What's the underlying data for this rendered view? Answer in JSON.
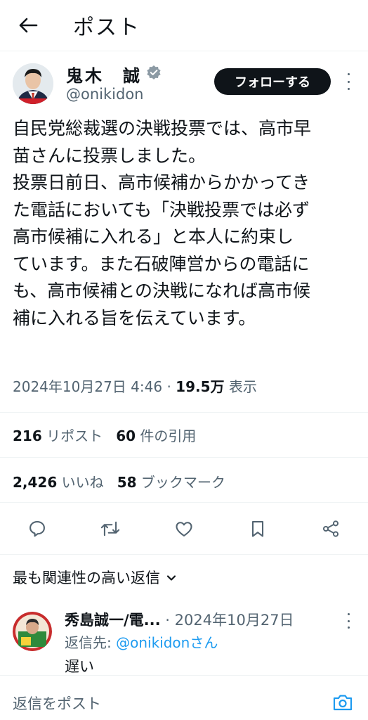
{
  "header": {
    "title": "ポスト"
  },
  "author": {
    "name": "鬼木　誠",
    "handle": "@onikidon",
    "follow_label": "フォローする"
  },
  "tweet": {
    "lines": [
      "自民党総裁選の決戦投票では、高市早",
      "苗さんに投票しました。",
      "投票日前日、高市候補からかかってき",
      "た電話においても「決戦投票では必ず",
      "高市候補に入れる」と本人に約束し",
      "ています。また石破陣営からの電話に",
      "も、高市候補との決戦になれば高市候",
      "補に入れる旨を伝えています。"
    ],
    "timestamp": "2024年10月27日 4:46",
    "separator": "·",
    "views": "19.5万",
    "views_label": "表示"
  },
  "stats": {
    "reposts": "216",
    "reposts_label": "リポスト",
    "quotes": "60",
    "quotes_label": "件の引用",
    "likes": "2,426",
    "likes_label": "いいね",
    "bookmarks": "58",
    "bookmarks_label": "ブックマーク"
  },
  "actions": [
    "reply-icon",
    "repost-icon",
    "like-icon",
    "bookmark-icon",
    "share-icon"
  ],
  "replies": {
    "sort_label": "最も関連性の高い返信",
    "items": [
      {
        "name": "秀島誠一/電...",
        "separator": "·",
        "date": "2024年10月27日",
        "reply_to_label": "返信先:",
        "reply_to_handle": "@onikidonさん",
        "text": "遅い"
      }
    ]
  },
  "compose": {
    "placeholder": "返信をポスト"
  },
  "colors": {
    "accent": "#1d9bf0",
    "text": "#0f1419",
    "muted": "#536471",
    "divider": "#eff3f4"
  }
}
